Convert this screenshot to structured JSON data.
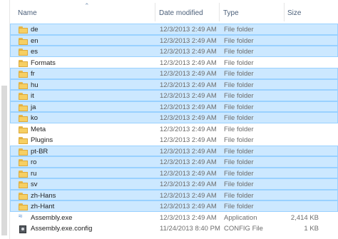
{
  "columns": {
    "name": "Name",
    "date_modified": "Date modified",
    "type": "Type",
    "size": "Size"
  },
  "files": [
    {
      "name": "de",
      "date": "12/3/2013 2:49 AM",
      "type": "File folder",
      "size": "",
      "icon": "folder-icon",
      "selected": true
    },
    {
      "name": "en",
      "date": "12/3/2013 2:49 AM",
      "type": "File folder",
      "size": "",
      "icon": "folder-icon",
      "selected": true
    },
    {
      "name": "es",
      "date": "12/3/2013 2:49 AM",
      "type": "File folder",
      "size": "",
      "icon": "folder-icon",
      "selected": true
    },
    {
      "name": "Formats",
      "date": "12/3/2013 2:49 AM",
      "type": "File folder",
      "size": "",
      "icon": "folder-icon",
      "selected": false
    },
    {
      "name": "fr",
      "date": "12/3/2013 2:49 AM",
      "type": "File folder",
      "size": "",
      "icon": "folder-icon",
      "selected": true
    },
    {
      "name": "hu",
      "date": "12/3/2013 2:49 AM",
      "type": "File folder",
      "size": "",
      "icon": "folder-icon",
      "selected": true
    },
    {
      "name": "it",
      "date": "12/3/2013 2:49 AM",
      "type": "File folder",
      "size": "",
      "icon": "folder-icon",
      "selected": true
    },
    {
      "name": "ja",
      "date": "12/3/2013 2:49 AM",
      "type": "File folder",
      "size": "",
      "icon": "folder-icon",
      "selected": true
    },
    {
      "name": "ko",
      "date": "12/3/2013 2:49 AM",
      "type": "File folder",
      "size": "",
      "icon": "folder-icon",
      "selected": true
    },
    {
      "name": "Meta",
      "date": "12/3/2013 2:49 AM",
      "type": "File folder",
      "size": "",
      "icon": "folder-icon",
      "selected": false
    },
    {
      "name": "Plugins",
      "date": "12/3/2013 2:49 AM",
      "type": "File folder",
      "size": "",
      "icon": "folder-icon",
      "selected": false
    },
    {
      "name": "pt-BR",
      "date": "12/3/2013 2:49 AM",
      "type": "File folder",
      "size": "",
      "icon": "folder-icon",
      "selected": true
    },
    {
      "name": "ro",
      "date": "12/3/2013 2:49 AM",
      "type": "File folder",
      "size": "",
      "icon": "folder-icon",
      "selected": true
    },
    {
      "name": "ru",
      "date": "12/3/2013 2:49 AM",
      "type": "File folder",
      "size": "",
      "icon": "folder-icon",
      "selected": true
    },
    {
      "name": "sv",
      "date": "12/3/2013 2:49 AM",
      "type": "File folder",
      "size": "",
      "icon": "folder-icon",
      "selected": true
    },
    {
      "name": "zh-Hans",
      "date": "12/3/2013 2:49 AM",
      "type": "File folder",
      "size": "",
      "icon": "folder-icon",
      "selected": true
    },
    {
      "name": "zh-Hant",
      "date": "12/3/2013 2:49 AM",
      "type": "File folder",
      "size": "",
      "icon": "folder-icon",
      "selected": true
    },
    {
      "name": "Assembly.exe",
      "date": "12/3/2013 2:49 AM",
      "type": "Application",
      "size": "2,414 KB",
      "icon": "application-icon",
      "selected": false
    },
    {
      "name": "Assembly.exe.config",
      "date": "11/24/2013 8:40 PM",
      "type": "CONFIG File",
      "size": "1 KB",
      "icon": "config-file-icon",
      "selected": false
    }
  ],
  "colors": {
    "selection_fill": "#cce8ff",
    "selection_border": "#99d1ff",
    "header_text": "#4c607a",
    "folder_yellow": "#f6cf63"
  }
}
